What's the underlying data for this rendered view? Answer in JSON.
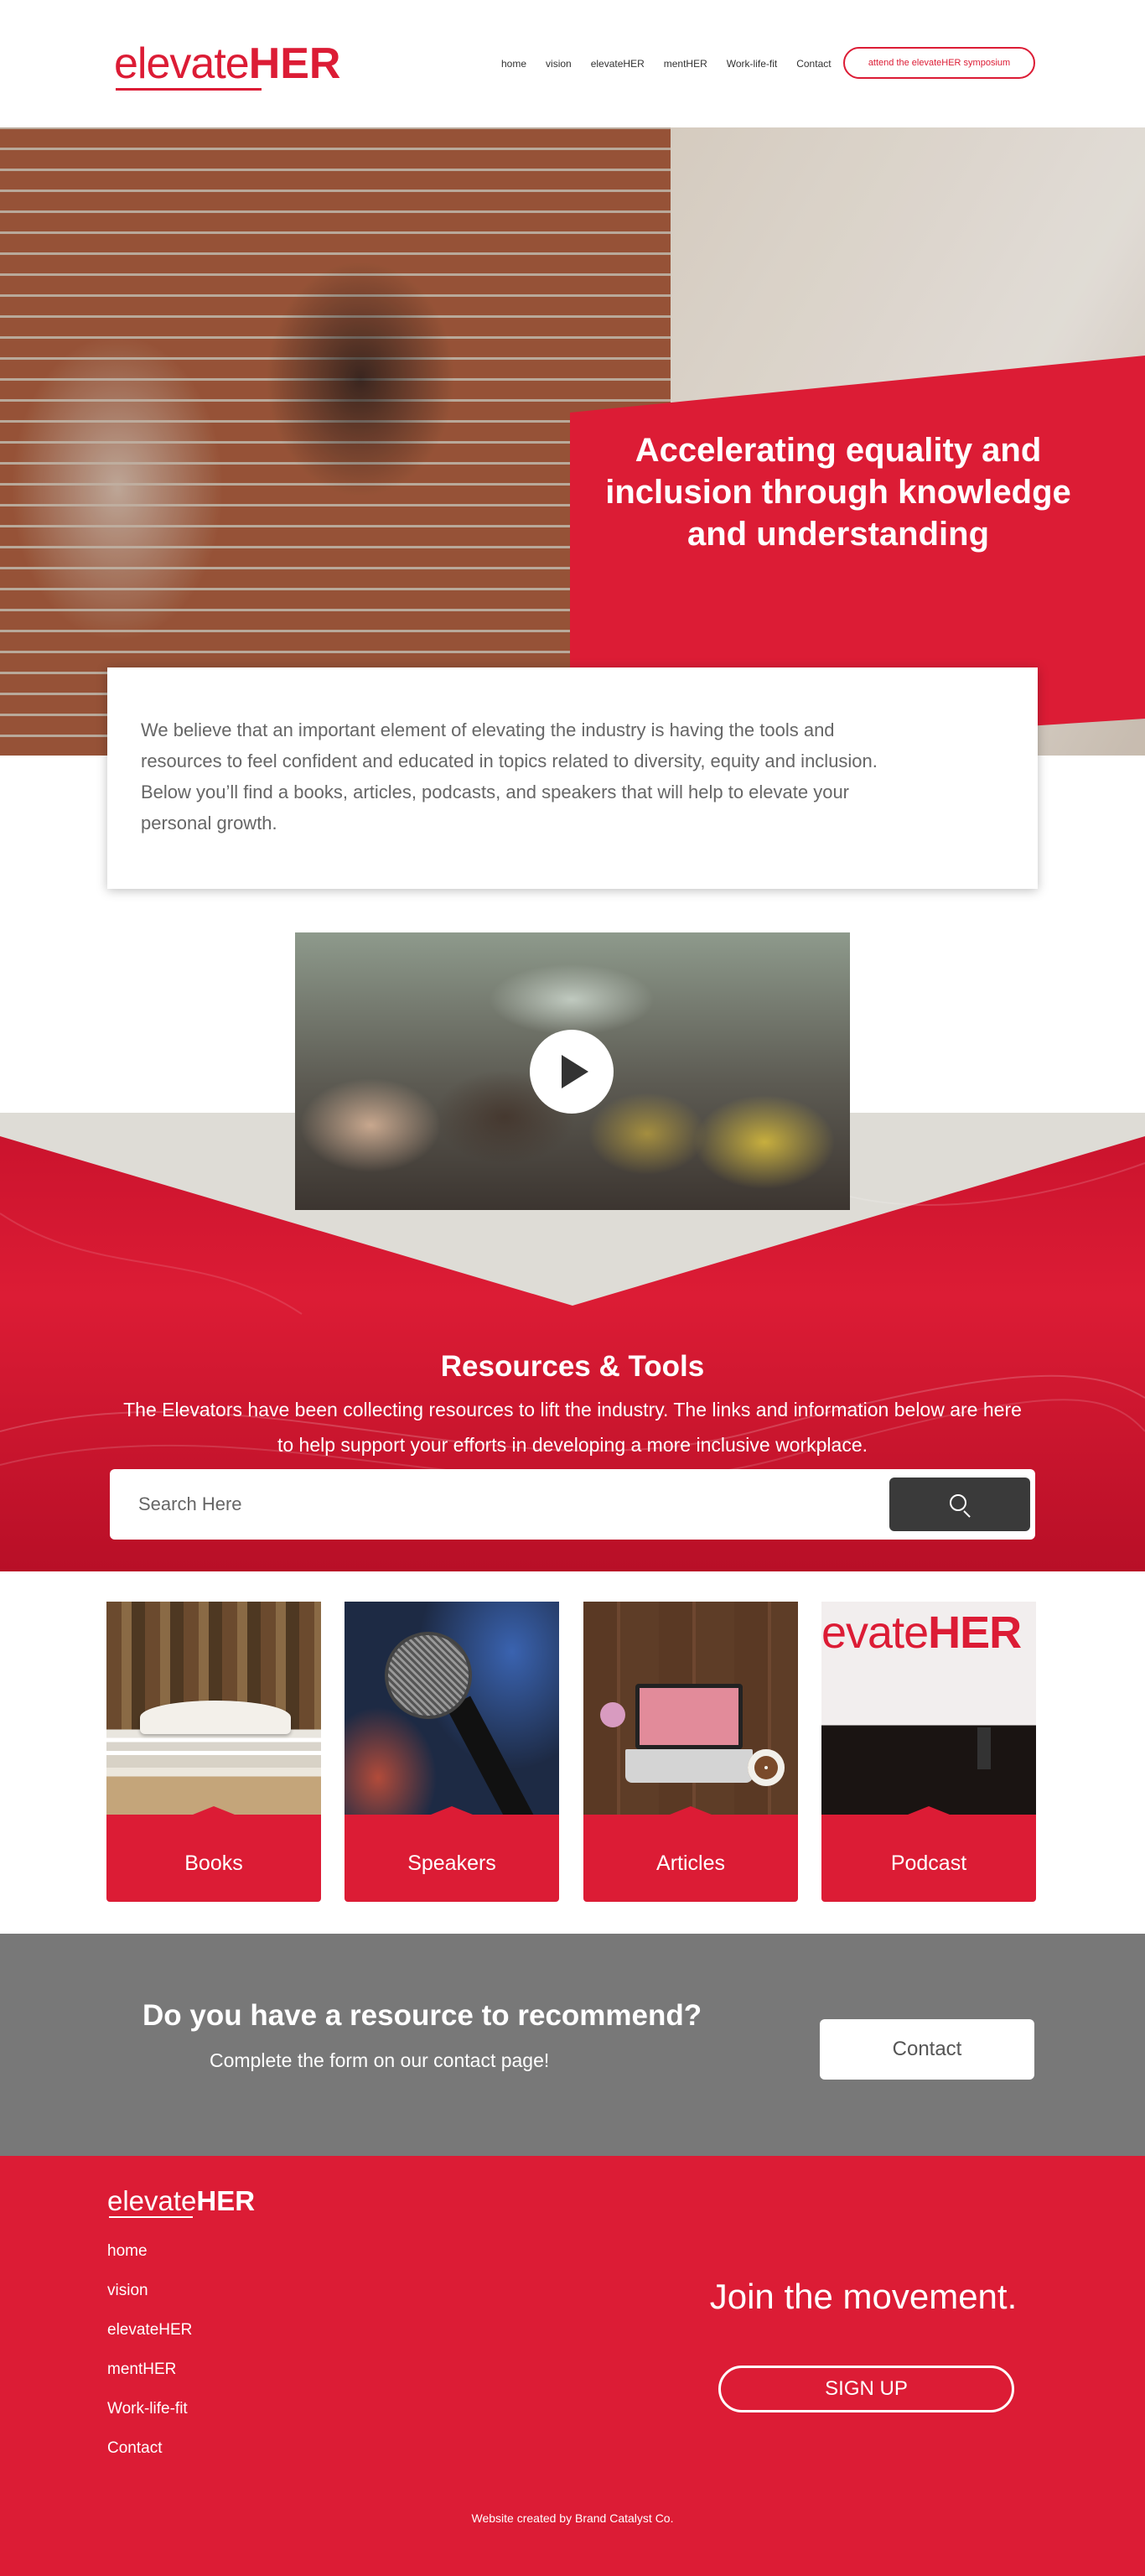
{
  "header": {
    "logo_light": "elevate",
    "logo_bold": "HER",
    "nav": [
      "home",
      "vision",
      "elevateHER",
      "mentHER",
      "Work-life-fit",
      "Contact"
    ],
    "cta": "attend the elevateHER symposium"
  },
  "hero": {
    "title": "Accelerating equality and inclusion through knowledge and understanding",
    "intro": "We believe that an important element of elevating the industry is having the tools and resources to feel confident and educated in topics related to diversity, equity and inclusion. Below you’ll find a books, articles, podcasts, and speakers that will help to elevate your personal growth."
  },
  "resources": {
    "title": "Resources & Tools",
    "subtitle": "The Elevators have been collecting resources to lift the industry. The links and information below are here to help support your efforts in developing a more inclusive workplace.",
    "search_placeholder": "Search Here",
    "cards": [
      {
        "label": "Books"
      },
      {
        "label": "Speakers"
      },
      {
        "label": "Articles"
      },
      {
        "label": "Podcast"
      }
    ],
    "podcast_stage_light": "evate",
    "podcast_stage_bold": "HER"
  },
  "recommend": {
    "title": "Do you have a resource to recommend?",
    "subtitle": "Complete the form on our contact page!",
    "button": "Contact"
  },
  "footer": {
    "logo_light": "elevate",
    "logo_bold": "HER",
    "nav": [
      "home",
      "vision",
      "elevateHER",
      "mentHER",
      "Work-life-fit",
      "Contact"
    ],
    "join": "Join the movement.",
    "signup": "SIGN UP",
    "credit_prefix": "Website created by ",
    "credit_name": "Brand Catalyst Co."
  },
  "colors": {
    "brand_red": "#dc1c35",
    "dark_button": "#3a3a3a",
    "grey_band": "#787878"
  },
  "icons": {
    "search": "search-icon",
    "play": "play-icon"
  }
}
